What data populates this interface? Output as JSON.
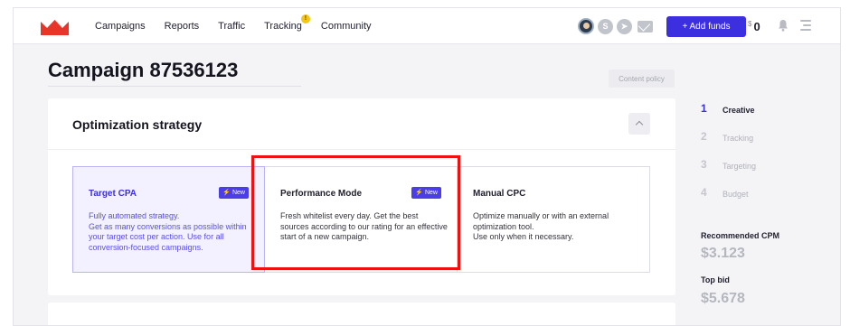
{
  "header": {
    "nav": [
      "Campaigns",
      "Reports",
      "Traffic",
      "Tracking",
      "Community"
    ],
    "tracking_badge": "!",
    "add_funds": "+ Add funds",
    "currency": "$",
    "balance": "0",
    "brand_color": "#3b2fe0"
  },
  "page": {
    "title": "Campaign 87536123",
    "content_policy": "Content policy"
  },
  "strategy": {
    "title": "Optimization strategy",
    "options": [
      {
        "title": "Target CPA",
        "badge": "⚡ New",
        "desc": "Fully automated strategy.\nGet as many conversions as possible within your target cost per action. Use for all conversion-focused campaigns."
      },
      {
        "title": "Performance Mode",
        "badge": "⚡ New",
        "desc": "Fresh whitelist every day. Get the best sources according to our rating for an effective start of a new campaign."
      },
      {
        "title": "Manual CPC",
        "desc": "Optimize manually or with an external optimization tool.\nUse only when it necessary."
      }
    ]
  },
  "steps": [
    {
      "num": "1",
      "label": "Creative"
    },
    {
      "num": "2",
      "label": "Tracking"
    },
    {
      "num": "3",
      "label": "Targeting"
    },
    {
      "num": "4",
      "label": "Budget"
    }
  ],
  "recommended_cpm": {
    "label": "Recommended CPM",
    "value": "$3.123"
  },
  "top_bid": {
    "label": "Top bid",
    "value": "$5.678"
  }
}
